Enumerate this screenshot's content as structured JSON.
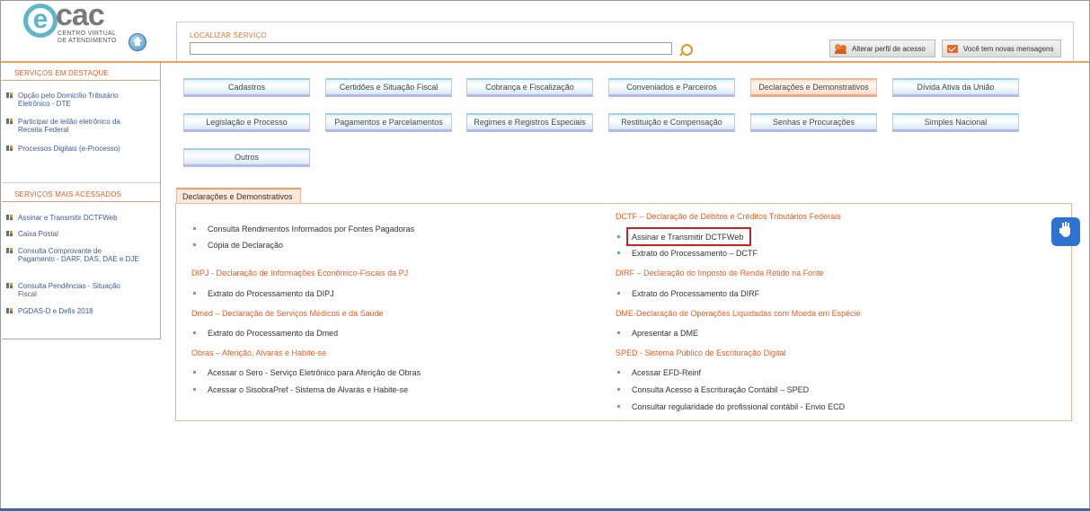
{
  "logo": {
    "letter": "e",
    "name": "cac",
    "subtitle_line1": "CENTRO VIRTUAL",
    "subtitle_line2": "DE ATENDIMENTO"
  },
  "search": {
    "label": "LOCALIZAR SERVIÇO",
    "value": "",
    "placeholder": ""
  },
  "header_actions": {
    "profile_label": "Alterar perfil de acesso",
    "messages_label": "Você tem novas mensagens"
  },
  "sidebar": {
    "featured_title": "SERVIÇOS EM DESTAQUE",
    "featured_items": [
      {
        "label": "Opção pelo Domicílio Tributário Eletrônico - DTE"
      },
      {
        "label": "Participar de leilão eletrônico da Receita Federal"
      },
      {
        "label": "Processos Digitais (e-Processo)"
      }
    ],
    "most_accessed_title": "SERVIÇOS MAIS ACESSADOS",
    "most_accessed_items": [
      {
        "label": "Assinar e Transmitir DCTFWeb"
      },
      {
        "label": "Caixa Postal"
      },
      {
        "label": "Consulta Comprovante de Pagamento - DARF, DAS, DAE e DJE"
      },
      {
        "label": "Consulta Pendências - Situação Fiscal"
      },
      {
        "label": "PGDAS-D e Defis 2018"
      }
    ]
  },
  "categories": [
    {
      "label": "Cadastros"
    },
    {
      "label": "Certidões e Situação Fiscal"
    },
    {
      "label": "Cobrança e Fiscalização"
    },
    {
      "label": "Conveniados e Parceiros"
    },
    {
      "label": "Declarações e Demonstrativos"
    },
    {
      "label": "Dívida Ativa da União"
    },
    {
      "label": "Legislação e Processo"
    },
    {
      "label": "Pagamentos e Parcelamentos"
    },
    {
      "label": "Regimes e Registros Especiais"
    },
    {
      "label": "Restituição e Compensação"
    },
    {
      "label": "Senhas e Procurações"
    },
    {
      "label": "Simples Nacional"
    },
    {
      "label": "Outros"
    }
  ],
  "content": {
    "tab_label": "Declarações e Demonstrativos",
    "left_top_items": [
      "Consulta Rendimentos Informados por Fontes Pagadoras",
      "Cópia de Declaração"
    ],
    "sections": {
      "dipj_title": "DIPJ - Declaração de Informações Econômico-Fiscais da PJ",
      "dipj_items": [
        "Extrato do Processamento da DIPJ"
      ],
      "dmed_title": "Dmed – Declaração de Serviços Médicos e da Saúde",
      "dmed_items": [
        "Extrato do Processamento da Dmed"
      ],
      "obras_title": "Obras – Aferição, Alvarás e Habite-se",
      "obras_items": [
        "Acessar o Sero - Serviço Eletrônico para Aferição de Obras",
        "Acessar o SisobraPref - Sistema de Alvarás e Habite-se"
      ],
      "dctf_title": "DCTF – Declaração de Débitos e Créditos Tributários Federais",
      "dctf_items": [
        "Assinar e Transmitir DCTFWeb",
        "Extrato do Processamento – DCTF"
      ],
      "dirf_title": "DIRF – Declaração do Imposto de Renda Retido na Fonte",
      "dirf_items": [
        "Extrato do Processamento da DIRF"
      ],
      "dme_title": "DME-Declaração de Operações Liquidadas com Moeda em Espécie",
      "dme_items": [
        "Apresentar a DME"
      ],
      "sped_title": "SPED - Sistema Público de Escrituração Digital",
      "sped_items": [
        "Acessar EFD-Reinf",
        "Consulta Acesso à Escrituração Contábil – SPED",
        "Consultar regularidade do profissional contábil - Envio ECD"
      ]
    }
  },
  "colors": {
    "accent_orange": "#e0602a",
    "link_blue": "#3b5b9b",
    "highlight_red": "#cc2222",
    "accessibility_blue": "#2e72d2"
  }
}
